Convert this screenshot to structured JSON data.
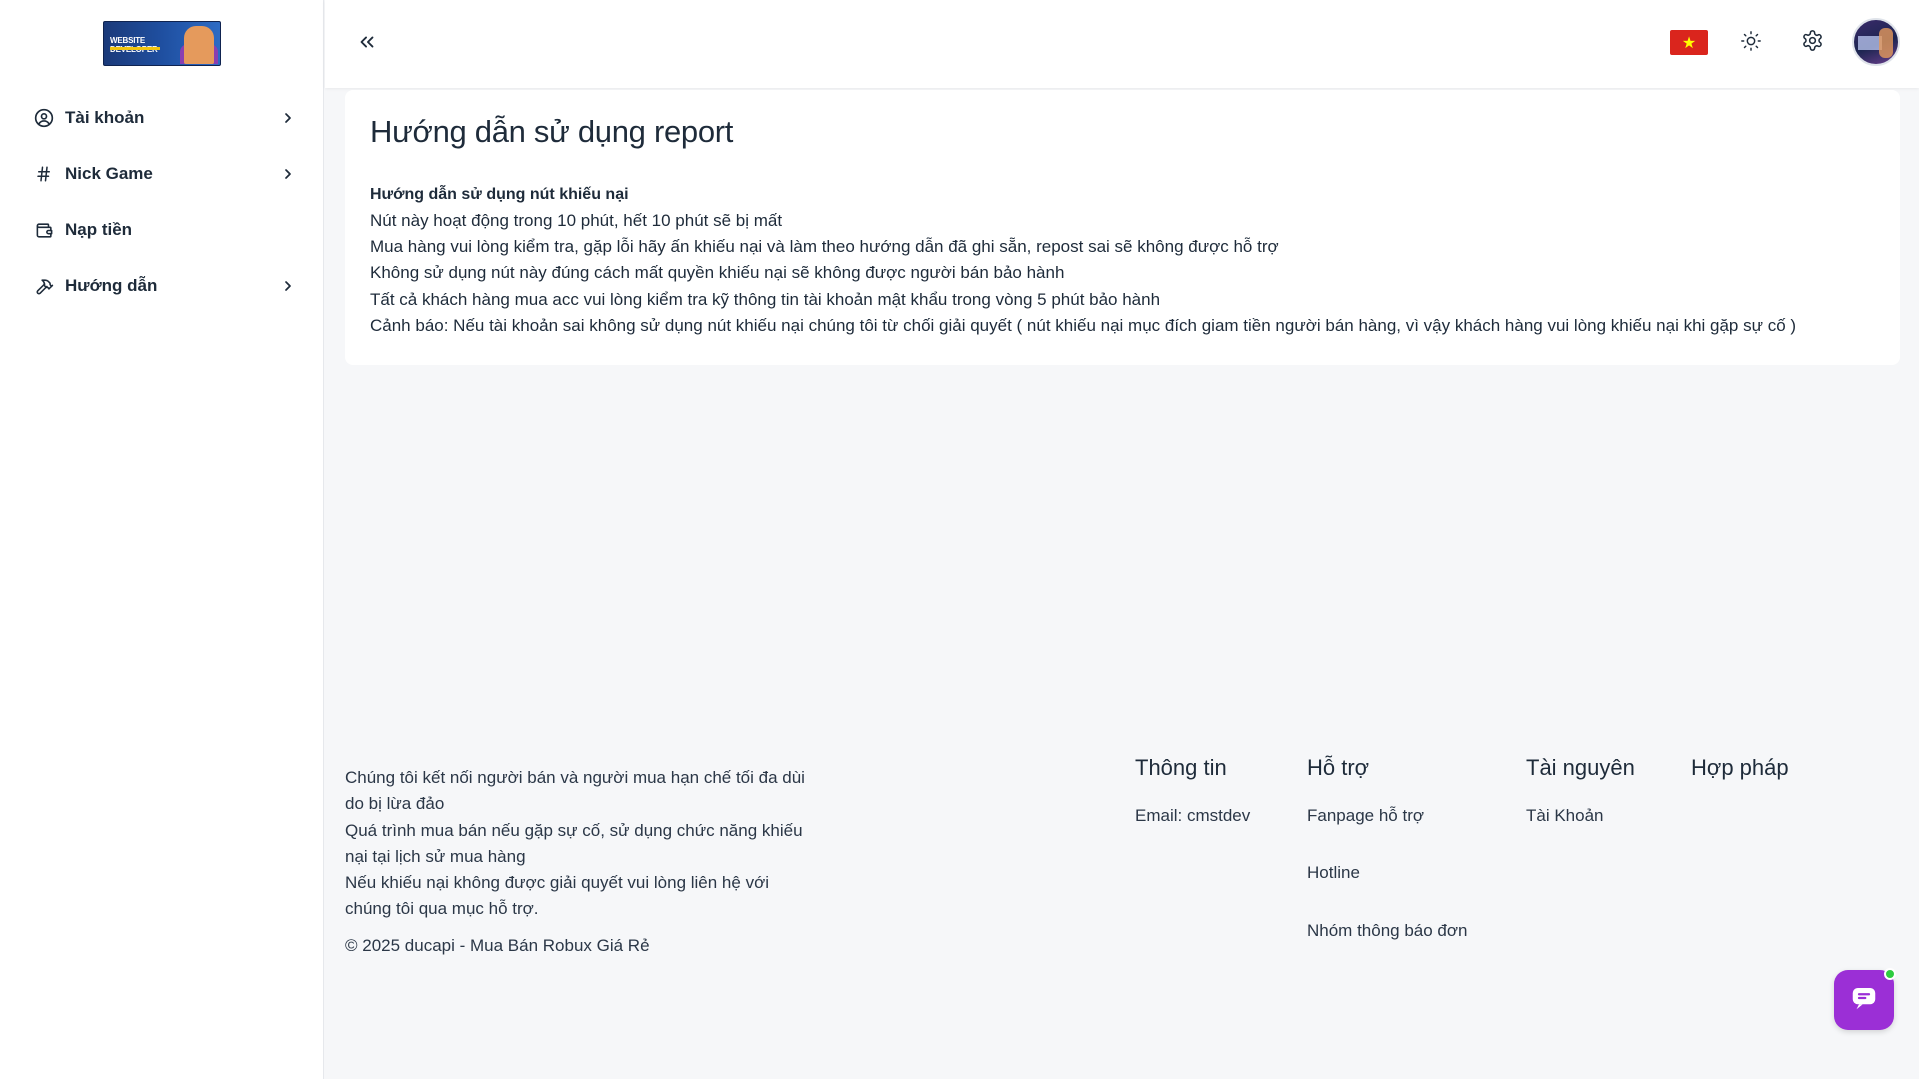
{
  "logo": {
    "text": "WEBSITE DEVELOPER"
  },
  "sidebar": {
    "items": [
      {
        "label": "Tài khoản",
        "icon": "user-circle-icon",
        "has_chevron": true
      },
      {
        "label": "Nick Game",
        "icon": "hash-icon",
        "has_chevron": true
      },
      {
        "label": "Nạp tiền",
        "icon": "wallet-icon",
        "has_chevron": false
      },
      {
        "label": "Hướng dẫn",
        "icon": "hammer-icon",
        "has_chevron": true
      }
    ]
  },
  "header": {
    "collapse_icon": "chevrons-left-icon",
    "flag": "vietnam-flag-icon",
    "theme_icon": "sun-icon",
    "settings_icon": "gear-icon",
    "avatar": "user-avatar"
  },
  "card": {
    "title": "Hướng dẫn sử dụng report",
    "subtitle": "Hướng dẫn sử dụng nút khiếu nại",
    "lines": [
      "Nút này hoạt động trong 10 phút, hết 10 phút sẽ bị mất",
      "Mua hàng vui lòng kiểm tra, gặp lỗi hãy ấn khiếu nại và làm theo hướng dẫn đã ghi sẵn, repost sai sẽ không được hỗ trợ",
      "Không sử dụng nút này đúng cách mất quyền khiếu nại sẽ không được người bán bảo hành",
      "Tất cả khách hàng mua acc vui lòng kiểm tra kỹ thông tin tài khoản mật khẩu trong vòng 5 phút bảo hành",
      "Cảnh báo: Nếu tài khoản sai không sử dụng nút khiếu nại chúng tôi từ chối giải quyết ( nút khiếu nại mục đích giam tiền người bán hàng, vì vậy khách hàng vui lòng khiếu nại khi gặp sự cố )"
    ]
  },
  "footer": {
    "about_lines": [
      "Chúng tôi kết nối người bán và người mua hạn chế tối đa dùi",
      "do bị lừa đảo",
      "Quá trình mua bán nếu gặp sự cố, sử dụng chức năng khiếu",
      "nại tại lịch sử mua hàng",
      "Nếu khiếu nại không được giải quyết vui lòng liên hệ với",
      "chúng tôi qua mục hỗ trợ."
    ],
    "copyright": "© 2025 ducapi - Mua Bán Robux Giá Rẻ",
    "columns": [
      {
        "heading": "Thông tin",
        "links": [
          "Email: cmstdev"
        ]
      },
      {
        "heading": "Hỗ trợ",
        "links": [
          "Fanpage hỗ trợ",
          "Hotline",
          "Nhóm thông báo đơn"
        ]
      },
      {
        "heading": "Tài nguyên",
        "links": [
          "Tài Khoản"
        ]
      },
      {
        "heading": "Hợp pháp",
        "links": []
      }
    ]
  },
  "chat": {
    "icon": "chat-bubble-icon",
    "status_color": "#2ecc40",
    "accent": "#9b2fd6"
  }
}
